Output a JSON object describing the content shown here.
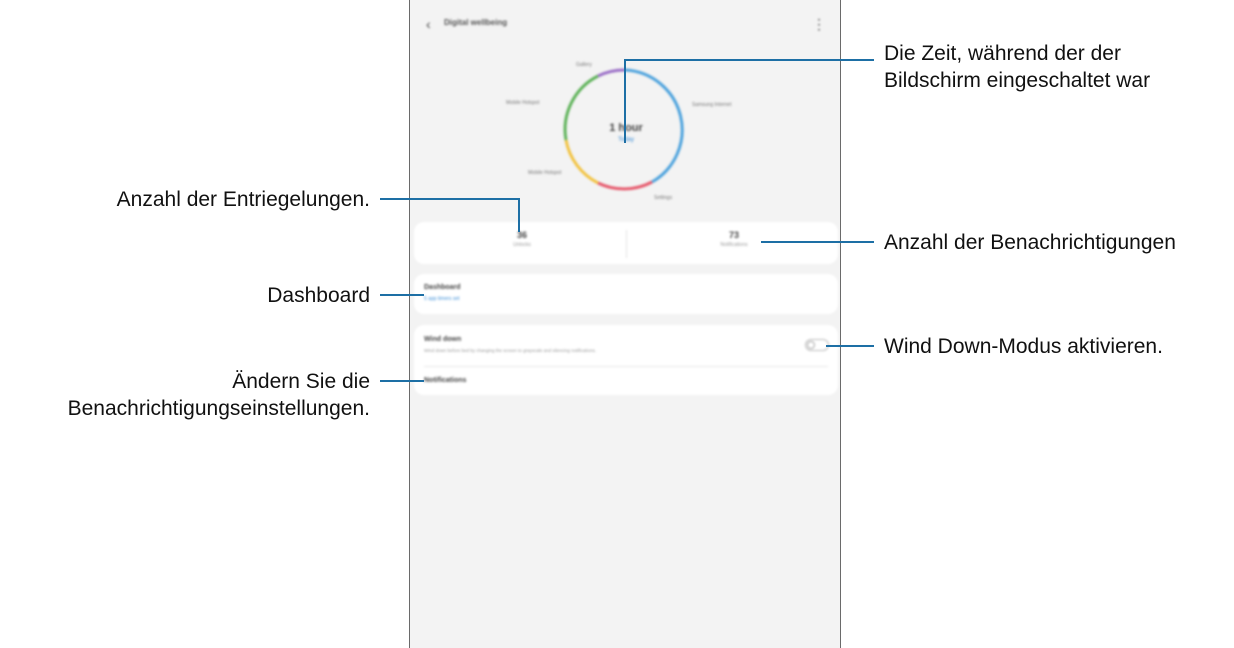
{
  "screen": {
    "app_title": "Digital wellbeing",
    "chart": {
      "center_time": "1 hour",
      "center_subtitle": "Today",
      "app_labels": [
        "Gallery",
        "Samsung Internet",
        "Mobile Hotspot",
        "Mobile Hotspot",
        "Settings",
        "Mobile Hotspot"
      ]
    },
    "stats": {
      "unlocks_value": "36",
      "unlocks_label": "Unlocks",
      "notifications_value": "73",
      "notifications_label": "Notifications"
    },
    "dashboard": {
      "title": "Dashboard",
      "subtitle": "5 app timers set"
    },
    "wind_down": {
      "title": "Wind down",
      "description": "Wind down before bed by changing the screen to grayscale and silencing notifications.",
      "enabled": false
    },
    "notifications_row": {
      "title": "Notifications"
    }
  },
  "annotations": {
    "screen_time": [
      "Die Zeit, während der der",
      "Bildschirm eingeschaltet war"
    ],
    "unlocks": "Anzahl der Entriegelungen.",
    "notifications": "Anzahl der Benachrichtigungen",
    "dashboard": "Dashboard",
    "wind_down": "Wind Down-Modus aktivieren.",
    "notification_settings": [
      "Ändern Sie die",
      "Benachrichtigungseinstellungen."
    ]
  },
  "colors": {
    "annotation_line": "#1d6fa5",
    "donut_blue": "#4ea3dd",
    "donut_red": "#e65b6e",
    "donut_yellow": "#f2c342",
    "donut_green": "#5fb35a",
    "donut_purple": "#9b6fc7"
  }
}
